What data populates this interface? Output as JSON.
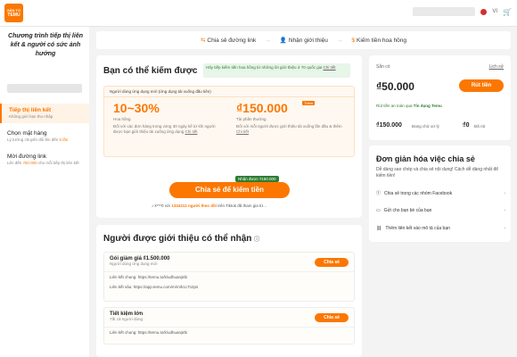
{
  "header": {
    "logo_top": "SẢN TỐ",
    "logo_bottom": "TEMU",
    "language": "VI"
  },
  "sidebar": {
    "title": "Chương trình tiếp thị liên kết & người có sức ảnh hưởng",
    "items": [
      {
        "label": "Tiếp thị liên kết",
        "sub": "Không giới hạn thu nhập"
      },
      {
        "label": "Chọn mặt hàng",
        "sub_pre": "Lý tưởng chuyển đổi lên đến ",
        "sub_hl": "5 lần"
      },
      {
        "label": "Mời đường link",
        "sub_pre": "Lên đến ",
        "sub_hl": "₫50.000",
        "sub_post": " cho mỗi tiếp thị liên kết"
      }
    ]
  },
  "steps": [
    "Chia sẻ đường link",
    "Nhận giới thiệu",
    "Kiếm tiền hoa hồng"
  ],
  "earn": {
    "title": "Bạn có thể kiếm được",
    "banner": "Hãy tiếp kiếm tiền hoa hồng từ những lời giới thiệu ở 70 quốc gia",
    "banner_link": "Chi tiết",
    "example_head": "Người dùng ứng dụng mới (ứng dụng tải xuống đầu tiên)",
    "commission_value": "10~30%",
    "commission_label": "Hoa hồng",
    "commission_desc": "Đối với các đơn hàng trong vòng 30 ngày kể từ khi người được bạn giới thiệu tải xuống ứng dụng",
    "commission_link": "Chi tiết",
    "reward_value": "₫150.000",
    "reward_tag": "Thêm",
    "reward_label": "Tài phần thưởng",
    "reward_desc": "Đối với mỗi người được giới thiệu tải xuống lần đầu & thêm",
    "reward_link": "Chi tiết",
    "cta": "Chia sẻ để kiếm tiền",
    "cta_badge": "Nhận được ₫150.000",
    "referral_pre": "k***0 với ",
    "referral_num": "1334312 người theo dõi",
    "referral_post": " trên Tiktok đã tham gia từ..."
  },
  "referred": {
    "title": "Người được giới thiệu có thể nhận",
    "offers": [
      {
        "title": "Gói giảm giá ₫1.500.000",
        "sub": "Người dùng ứng dụng mới",
        "button": "Chia sẻ",
        "links": [
          "Liên kết chung: https://temu.to/k/udhuarqkhi",
          "Liên kết sâu: https://app.temu.com/m/mih1c7n2ps"
        ]
      },
      {
        "title": "Tiết kiệm lớn",
        "sub": "Tất cả người dùng",
        "button": "Chia sẻ",
        "links": [
          "Liên kết chung: https://temu.to/k/udhuarqkhi"
        ]
      }
    ]
  },
  "balance": {
    "available_label": "Sẵn có",
    "history": "Lịch sử",
    "amount": "₫50.000",
    "withdraw": "Rút tiền",
    "secure": "Rút tiền an toàn qua",
    "secure_badge": "Tín dụng Temu",
    "pending_amount": "₫150.000",
    "pending_label": "Đang chờ xử lý",
    "paid_amount": "₫0",
    "paid_label": "Đã rút"
  },
  "share": {
    "title": "Đơn giản hóa việc chia sẻ",
    "desc": "Dễ dàng sao chép và chia sẻ nội dung! Cách dễ dàng nhất để kiếm tiền!",
    "rows": [
      "Chia sẻ trong các nhóm Facebook",
      "Gửi cho bạn bè của bạn",
      "Thêm liên kết vào mô tả của bạn"
    ]
  }
}
